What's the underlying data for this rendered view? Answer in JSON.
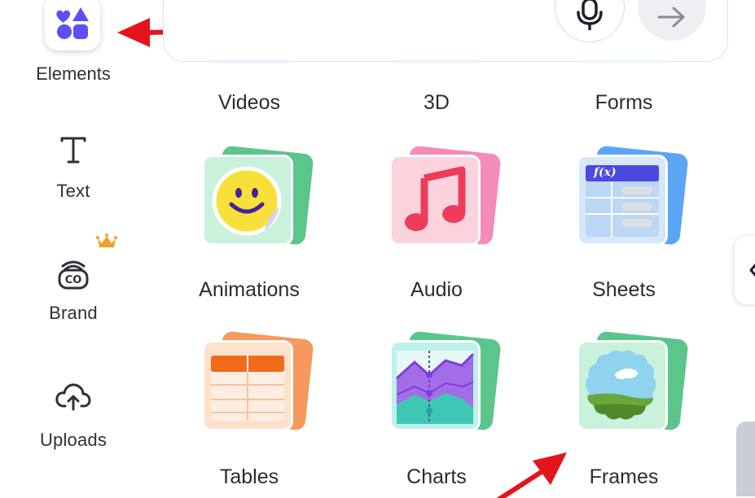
{
  "sidebar": {
    "items": [
      {
        "label": "Elements",
        "icon": "shapes-icon",
        "accent": "#5b4ff5"
      },
      {
        "label": "Text",
        "icon": "text-t-icon"
      },
      {
        "label": "Brand",
        "icon": "brand-kit-icon",
        "badge": "crown-icon",
        "badge_color": "#f2a12b"
      },
      {
        "label": "Uploads",
        "icon": "cloud-upload-icon"
      }
    ]
  },
  "search": {
    "buttons": [
      {
        "name": "microphone",
        "icon": "microphone-icon"
      },
      {
        "name": "submit",
        "icon": "arrow-right-icon"
      }
    ]
  },
  "categories": {
    "row1": [
      "Videos",
      "3D",
      "Forms"
    ],
    "row2": [
      "Animations",
      "Audio",
      "Sheets"
    ],
    "row3": [
      "Tables",
      "Charts",
      "Frames"
    ]
  },
  "sheets_card_text": "f(x)",
  "annotations": {
    "arrow_color": "#e3141b"
  }
}
